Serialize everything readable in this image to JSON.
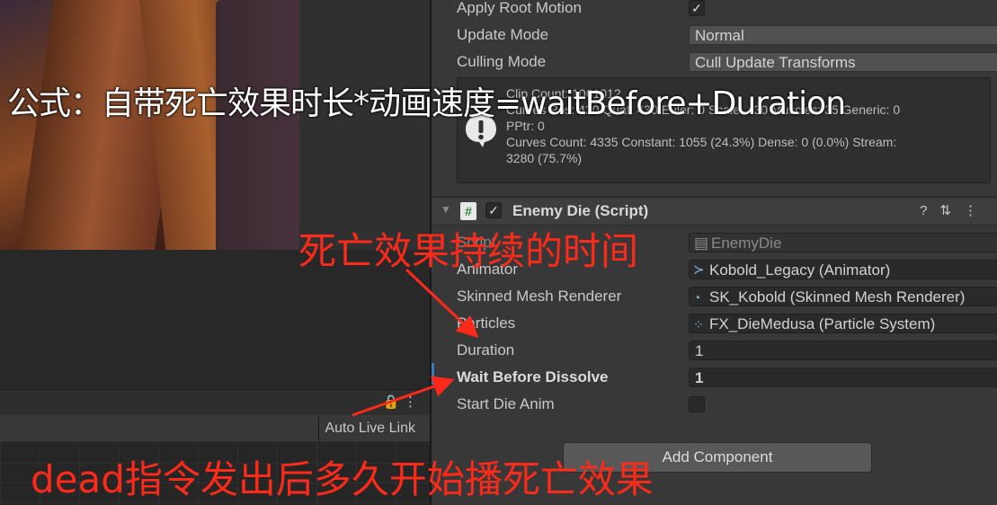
{
  "annotations": {
    "formula": "公式：自带死亡效果时长*动画速度=waitBefore+Duration",
    "duration_note": "死亡效果持续的时间",
    "wait_note": "dead指令发出后多久开始播死亡效果"
  },
  "animator_panel": {
    "auto_live_link": "Auto Live Link"
  },
  "inspector": {
    "apply_root_motion": {
      "label": "Apply Root Motion",
      "checked": true
    },
    "update_mode": {
      "label": "Update Mode",
      "value": "Normal"
    },
    "culling_mode": {
      "label": "Culling Mode",
      "value": "Cull Update Transforms"
    },
    "clip_info": {
      "line1": "Clip Count: 1061012",
      "line2": "Curves Pos: 430 Quat: 430 Euler: 0 Scale: 430 Muscles: 35 Generic: 0",
      "line3": "PPtr: 0",
      "line4": "Curves Count: 4335 Constant: 1055 (24.3%) Dense: 0 (0.0%) Stream:",
      "line5": "3280 (75.7%)"
    },
    "component": {
      "title": "Enemy Die (Script)",
      "script": {
        "label": "Script",
        "value": "EnemyDie"
      },
      "animator": {
        "label": "Animator",
        "value": "Kobold_Legacy (Animator)"
      },
      "skinned_mesh": {
        "label": "Skinned Mesh Renderer",
        "value": "SK_Kobold (Skinned Mesh Renderer)"
      },
      "particles": {
        "label": "Particles",
        "value": "FX_DieMedusa (Particle System)"
      },
      "duration": {
        "label": "Duration",
        "value": "1"
      },
      "wait_before": {
        "label": "Wait Before Dissolve",
        "value": "1"
      },
      "start_die_anim": {
        "label": "Start Die Anim",
        "checked": false
      }
    },
    "add_component": "Add Component"
  },
  "colors": {
    "annotation_red": "#ff2a1a",
    "panel_bg": "#383838",
    "field_bg": "#2a2a2a",
    "active_blue": "#3a79bb"
  }
}
